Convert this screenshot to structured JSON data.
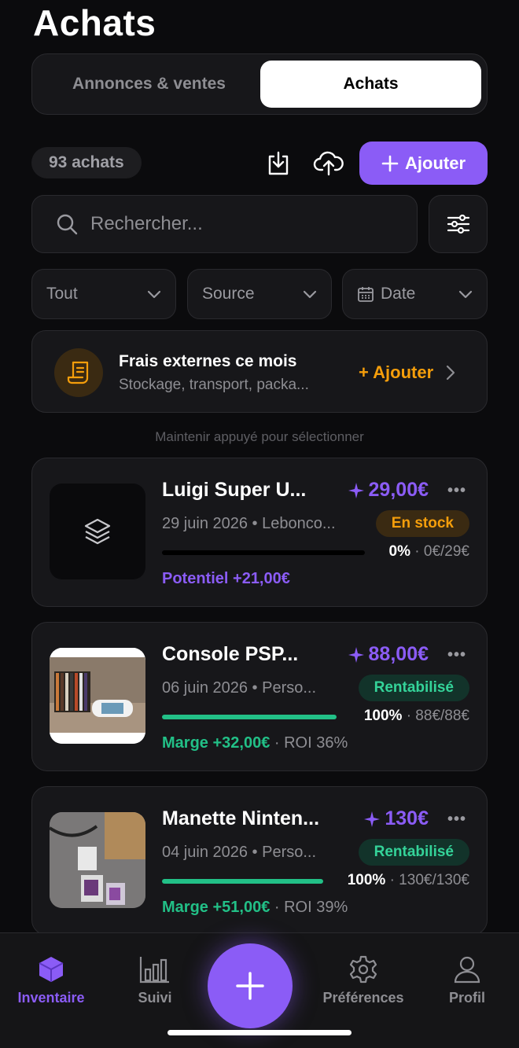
{
  "header": {
    "title": "Achats"
  },
  "segments": {
    "left": "Annonces & ventes",
    "right": "Achats",
    "selected": "Achats"
  },
  "toolbar": {
    "count": "93 achats",
    "add_label": "Ajouter"
  },
  "search": {
    "placeholder": "Rechercher..."
  },
  "filters": {
    "all": "Tout",
    "source": "Source",
    "date": "Date"
  },
  "fees": {
    "title": "Frais externes ce mois",
    "subtitle": "Stockage, transport, packa...",
    "add_label": "+ Ajouter"
  },
  "hint": "Maintenir appuyé pour sélectionner",
  "items": [
    {
      "name": "Luigi Super U...",
      "price": "29,00€",
      "meta": "29 juin 2026 • Leboncо...",
      "badge": "En stock",
      "progress": 0,
      "pct": "0%",
      "amount": "· 0€/29€",
      "footer": "Potentiel +21,00€",
      "roi": ""
    },
    {
      "name": "Console PSP...",
      "price": "88,00€",
      "meta": "06 juin 2026 • Perso...",
      "badge": "Rentabilisé",
      "progress": 1,
      "pct": "100%",
      "amount": "· 88€/88€",
      "footer": "Marge +32,00€",
      "roi": "· ROI 36%"
    },
    {
      "name": "Manette Ninten...",
      "price": "130€",
      "meta": "04 juin 2026 • Perso...",
      "badge": "Rentabilisé",
      "progress": 1,
      "pct": "100%",
      "amount": "· 130€/130€",
      "footer": "Marge +51,00€",
      "roi": "· ROI 39%"
    }
  ],
  "tabbar": {
    "inventory": "Inventaire",
    "tracking": "Suivi",
    "preferences": "Préférences",
    "profile": "Profil"
  },
  "colors": {
    "accent": "#8b5cf6",
    "success": "#22c087",
    "warning": "#f59e0b"
  }
}
